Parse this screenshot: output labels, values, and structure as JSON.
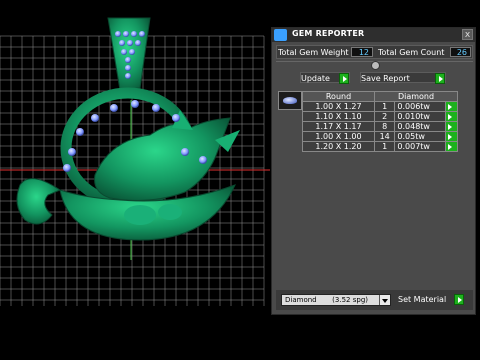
{
  "panel": {
    "title": "GEM REPORTER",
    "close_label": "x",
    "total_weight_label": "Total Gem Weight",
    "total_weight_value": "12",
    "total_count_label": "Total Gem Count",
    "total_count_value": "26",
    "update_label": "Update",
    "save_report_label": "Save Report",
    "table": {
      "headers": [
        "Round",
        "Diamond"
      ],
      "rows": [
        {
          "size": "1.00 X 1.27",
          "count": "1",
          "weight": "0.006tw"
        },
        {
          "size": "1.10 X 1.10",
          "count": "2",
          "weight": "0.010tw"
        },
        {
          "size": "1.17 X 1.17",
          "count": "8",
          "weight": "0.048tw"
        },
        {
          "size": "1.00 X 1.00",
          "count": "14",
          "weight": "0.05tw"
        },
        {
          "size": "1.20 X 1.20",
          "count": "1",
          "weight": "0.007tw"
        }
      ]
    },
    "material_value": "Diamond       (3.52 spg)",
    "set_material_label": "Set Material"
  },
  "colors": {
    "viewport_bg": "#000000",
    "grid": "#bfbfbf",
    "model": "#1a9a66",
    "gem_stone": "#7f96ff",
    "accent_green": "#1db11d",
    "stat_text": "#66ccff"
  }
}
